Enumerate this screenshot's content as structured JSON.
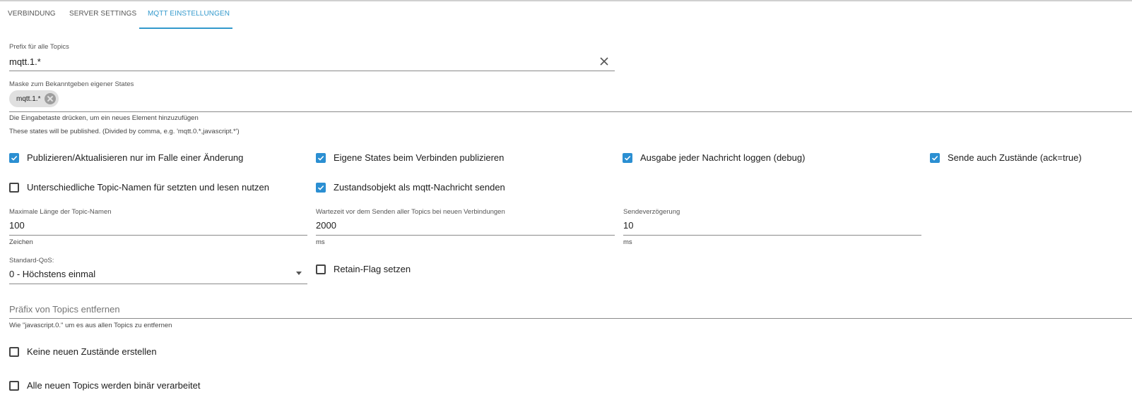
{
  "tabs": [
    {
      "label": "VERBINDUNG"
    },
    {
      "label": "SERVER SETTINGS"
    },
    {
      "label": "MQTT EINSTELLUNGEN"
    }
  ],
  "prefix": {
    "label": "Prefix für alle Topics",
    "value": "mqtt.1.*"
  },
  "mask": {
    "label": "Maske zum Bekanntgeben eigener States",
    "chip": "mqtt.1.*",
    "helper1": "Die Eingabetaste drücken, um ein neues Element hinzuzufügen",
    "helper2": "These states will be published. (Divided by comma, e.g. 'mqtt.0.*,javascript.*')"
  },
  "checkboxes": [
    {
      "label": "Publizieren/Aktualisieren nur im Falle einer Änderung",
      "checked": true
    },
    {
      "label": "Eigene States beim Verbinden publizieren",
      "checked": true
    },
    {
      "label": "Ausgabe jeder Nachricht loggen (debug)",
      "checked": true
    },
    {
      "label": "Sende auch Zustände (ack=true)",
      "checked": true
    },
    {
      "label": "Unterschiedliche Topic-Namen für setzten und lesen nutzen",
      "checked": false
    },
    {
      "label": "Zustandsobjekt als mqtt-Nachricht senden",
      "checked": true
    },
    {
      "label": "Retain-Flag setzen",
      "checked": false
    },
    {
      "label": "Keine neuen Zustände erstellen",
      "checked": false
    },
    {
      "label": "Alle neuen Topics werden binär verarbeitet",
      "checked": false
    }
  ],
  "maxlen": {
    "label": "Maximale Länge der Topic-Namen",
    "value": "100",
    "unit": "Zeichen"
  },
  "waittime": {
    "label": "Wartezeit vor dem Senden aller Topics bei neuen Verbindungen",
    "value": "2000",
    "unit": "ms"
  },
  "senddelay": {
    "label": "Sendeverzögerung",
    "value": "10",
    "unit": "ms"
  },
  "qos": {
    "label": "Standard-QoS:",
    "value": "0 - Höchstens einmal"
  },
  "removeprefix": {
    "placeholder": "Präfix von Topics entfernen",
    "helper": "Wie \"javascript.0.\" um es aus allen Topics zu entfernen"
  },
  "colors": {
    "accent": "#3399cc",
    "checkbox": "#2b8fd2"
  }
}
